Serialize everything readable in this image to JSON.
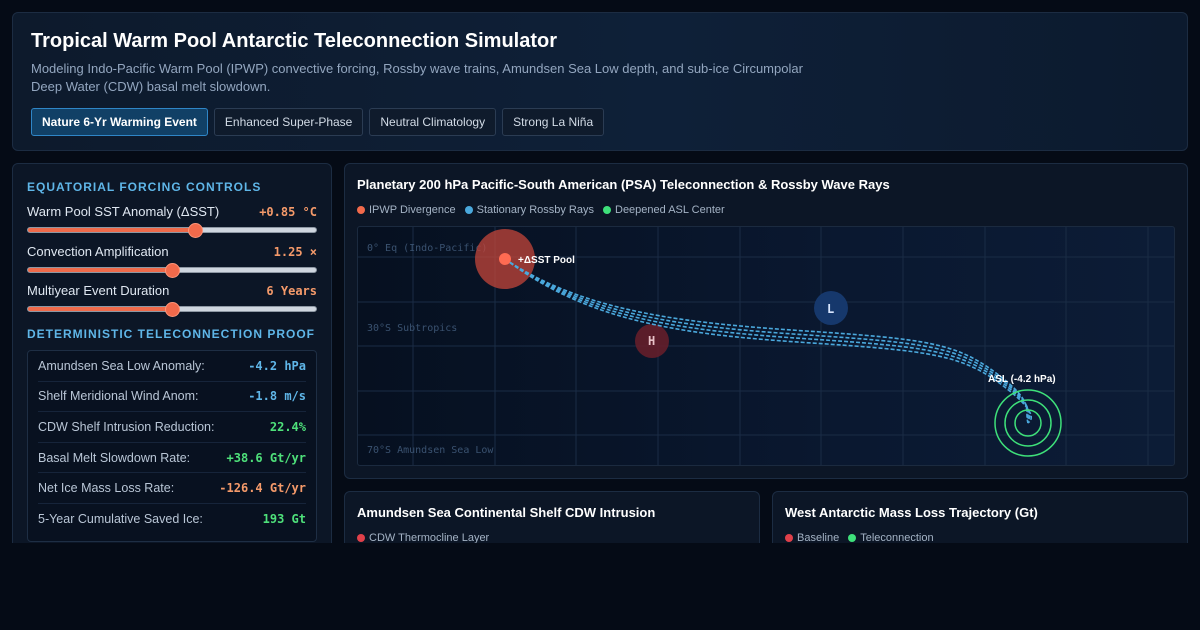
{
  "header": {
    "title": "Tropical Warm Pool Antarctic Teleconnection Simulator",
    "subtitle": "Modeling Indo-Pacific Warm Pool (IPWP) convective forcing, Rossby wave trains, Amundsen Sea Low depth, and sub-ice Circumpolar Deep Water (CDW) basal melt slowdown.",
    "tabs": [
      {
        "label": "Nature 6-Yr Warming Event",
        "active": true
      },
      {
        "label": "Enhanced Super-Phase",
        "active": false
      },
      {
        "label": "Neutral Climatology",
        "active": false
      },
      {
        "label": "Strong La Niña",
        "active": false
      }
    ]
  },
  "controls": {
    "forcing_title": "EQUATORIAL FORCING CONTROLS",
    "sliders": [
      {
        "label": "Warm Pool SST Anomaly (ΔSST)",
        "value": "+0.85 °C",
        "fraction": 0.58
      },
      {
        "label": "Convection Amplification",
        "value": "1.25 ×",
        "fraction": 0.5
      },
      {
        "label": "Multiyear Event Duration",
        "value": "6 Years",
        "fraction": 0.5
      }
    ],
    "proof_title": "DETERMINISTIC TELECONNECTION PROOF",
    "proof": [
      {
        "label": "Amundsen Sea Low Anomaly:",
        "value": "-4.2 hPa",
        "color": "#5fb6e8"
      },
      {
        "label": "Shelf Meridional Wind Anom:",
        "value": "-1.8 m/s",
        "color": "#5fb6e8"
      },
      {
        "label": "CDW Shelf Intrusion Reduction:",
        "value": "22.4%",
        "color": "#4ee07a"
      },
      {
        "label": "Basal Melt Slowdown Rate:",
        "value": "+38.6 Gt/yr",
        "color": "#4ee07a"
      },
      {
        "label": "Net Ice Mass Loss Rate:",
        "value": "-126.4 Gt/yr",
        "color": "#f59a6a"
      },
      {
        "label": "5-Year Cumulative Saved Ice:",
        "value": "193 Gt",
        "color": "#4ee07a"
      }
    ]
  },
  "map_card": {
    "title": "Planetary 200 hPa Pacific-South American (PSA) Teleconnection & Rossby Wave Rays",
    "legend": [
      {
        "label": "IPWP Divergence",
        "color": "#f26a4b"
      },
      {
        "label": "Stationary Rossby Rays",
        "color": "#4aa8dc"
      },
      {
        "label": "Deepened ASL Center",
        "color": "#3ee07a"
      }
    ],
    "lat_labels": [
      "0° Eq (Indo-Pacific)",
      "30°S Subtropics",
      "70°S Amundsen Sea Low"
    ],
    "pool_label": "+ΔSST Pool",
    "high_label": "H",
    "low_label": "L",
    "asl_label": "ASL (-4.2 hPa)"
  },
  "cdw_card": {
    "title": "Amundsen Sea Continental Shelf CDW Intrusion",
    "legend": [
      {
        "label": "CDW Thermocline Layer",
        "color": "#e0404a"
      }
    ]
  },
  "mass_card": {
    "title": "West Antarctic Mass Loss Trajectory (Gt)",
    "legend": [
      {
        "label": "Baseline",
        "color": "#e0404a"
      },
      {
        "label": "Teleconnection",
        "color": "#3ee07a"
      }
    ]
  }
}
